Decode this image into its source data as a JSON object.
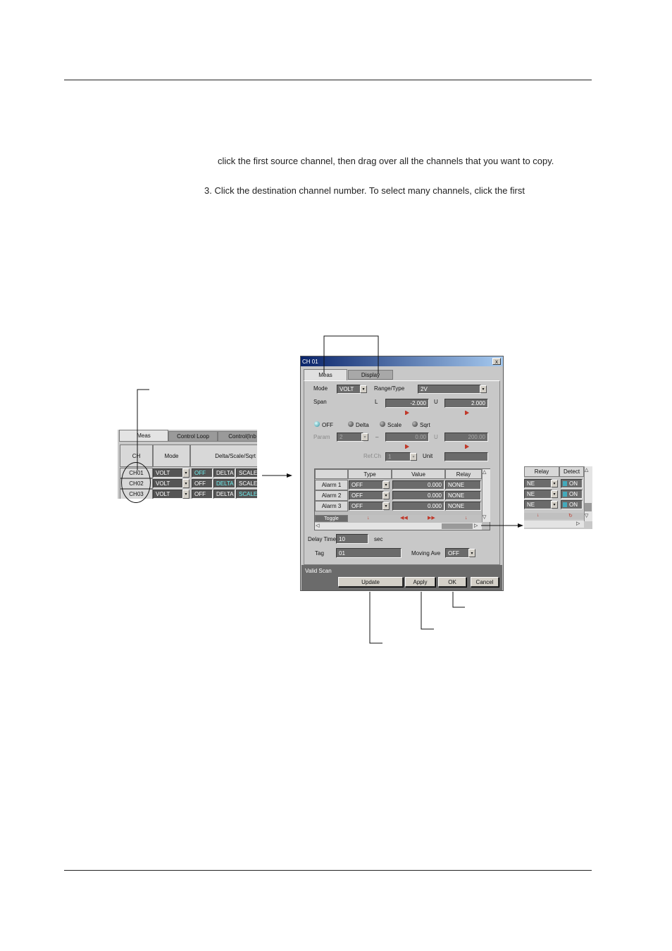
{
  "body": {
    "para1": "click the first source channel, then drag over all the channels that you want to copy.",
    "step3": "3.  Click the destination channel number.  To select many channels, click the first"
  },
  "left_panel": {
    "tabs": [
      "Meas",
      "Control Loop",
      "Control(Inb"
    ],
    "headers": [
      "CH",
      "Mode",
      "Delta/Scale/Sqrt"
    ],
    "rows": [
      {
        "ch": "CH01",
        "mode": "VOLT",
        "b1": "OFF",
        "b2": "DELTA",
        "b3": "SCALE"
      },
      {
        "ch": "CH02",
        "mode": "VOLT",
        "b1": "OFF",
        "b2": "DELTA",
        "b3": "SCALE"
      },
      {
        "ch": "CH03",
        "mode": "VOLT",
        "b1": "OFF",
        "b2": "DELTA",
        "b3": "SCALE"
      }
    ]
  },
  "dialog": {
    "title": "CH 01",
    "close": "x",
    "tabs": [
      "Meas",
      "Display"
    ],
    "mode_label": "Mode",
    "mode_value": "VOLT",
    "range_label": "Range/Type",
    "range_value": "2V",
    "span_label": "Span",
    "span_l_label": "L",
    "span_l_value": "-2.000",
    "span_u_label": "U",
    "span_u_value": "2.000",
    "radios": [
      "OFF",
      "Delta",
      "Scale",
      "Sqrt"
    ],
    "param_label": "Param",
    "param_value": "2",
    "param_dash": "–",
    "param_l_value": "0.00",
    "param_u_label": "U",
    "param_u_value": "200.00",
    "refch_label": "Ref.Ch",
    "refch_value": "1",
    "unit_label": "Unit",
    "unit_value": "",
    "alarm_headers": [
      "Type",
      "Value",
      "Relay"
    ],
    "alarms": [
      {
        "name": "Alarm 1",
        "type": "OFF",
        "value": "0.000",
        "relay": "NONE"
      },
      {
        "name": "Alarm 2",
        "type": "OFF",
        "value": "0.000",
        "relay": "NONE"
      },
      {
        "name": "Alarm 3",
        "type": "OFF",
        "value": "0.000",
        "relay": "NONE"
      }
    ],
    "toggle_label": "Toggle",
    "delay_label": "Delay Time",
    "delay_value": "10",
    "delay_unit": "sec",
    "tag_label": "Tag",
    "tag_value": "01",
    "moving_label": "Moving Ave",
    "moving_value": "OFF",
    "status": "Valid Scan",
    "buttons": {
      "update": "Update",
      "apply": "Apply",
      "ok": "OK",
      "cancel": "Cancel"
    }
  },
  "right_panel": {
    "headers": [
      "Relay",
      "Detect"
    ],
    "rows": [
      {
        "relay": "NE",
        "detect": "ON"
      },
      {
        "relay": "NE",
        "detect": "ON"
      },
      {
        "relay": "NE",
        "detect": "ON"
      }
    ]
  }
}
